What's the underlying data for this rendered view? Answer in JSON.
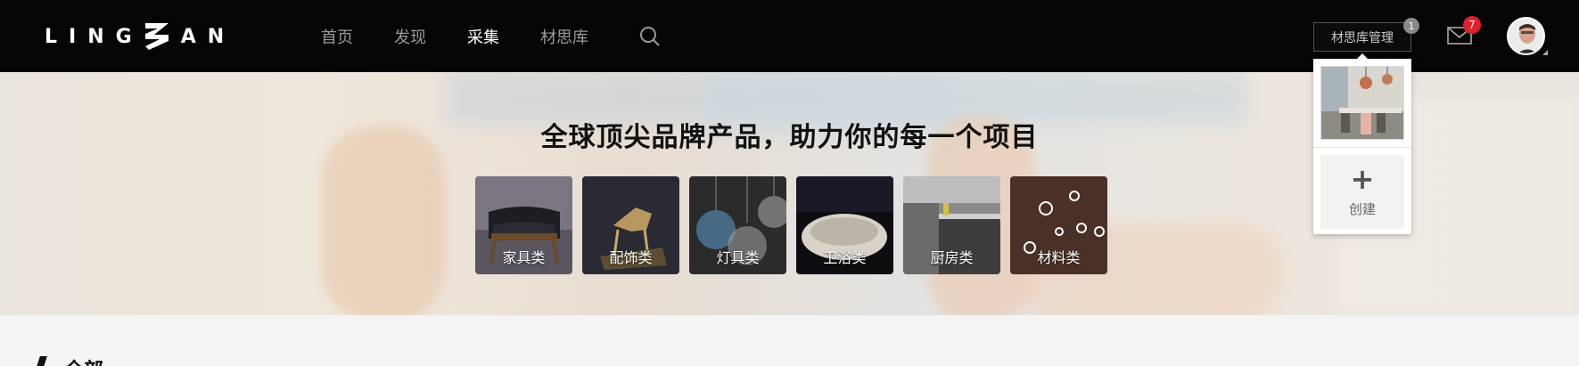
{
  "brand": {
    "logo_left": "LING",
    "logo_right": "AN"
  },
  "nav": {
    "items": [
      {
        "label": "首页"
      },
      {
        "label": "发现"
      },
      {
        "label": "采集"
      },
      {
        "label": "材思库"
      }
    ],
    "active": "采集",
    "search_icon": "search-icon"
  },
  "toolbar": {
    "library_button_label": "材思库管理",
    "library_badge": "1",
    "mail_icon": "mail-icon",
    "mail_badge": "7"
  },
  "hero": {
    "title": "全球顶尖品牌产品，助力你的每一个项目",
    "categories": [
      {
        "label": "家具类"
      },
      {
        "label": "配饰类"
      },
      {
        "label": "灯具类"
      },
      {
        "label": "卫浴类"
      },
      {
        "label": "厨房类"
      },
      {
        "label": "材料类"
      }
    ]
  },
  "library_dropdown": {
    "create_label": "创建",
    "create_icon": "plus-icon"
  },
  "section": {
    "title": "全部"
  },
  "colors": {
    "topbar": "#050505",
    "badge_red": "#e0202d",
    "badge_grey": "#8a8a8a"
  }
}
